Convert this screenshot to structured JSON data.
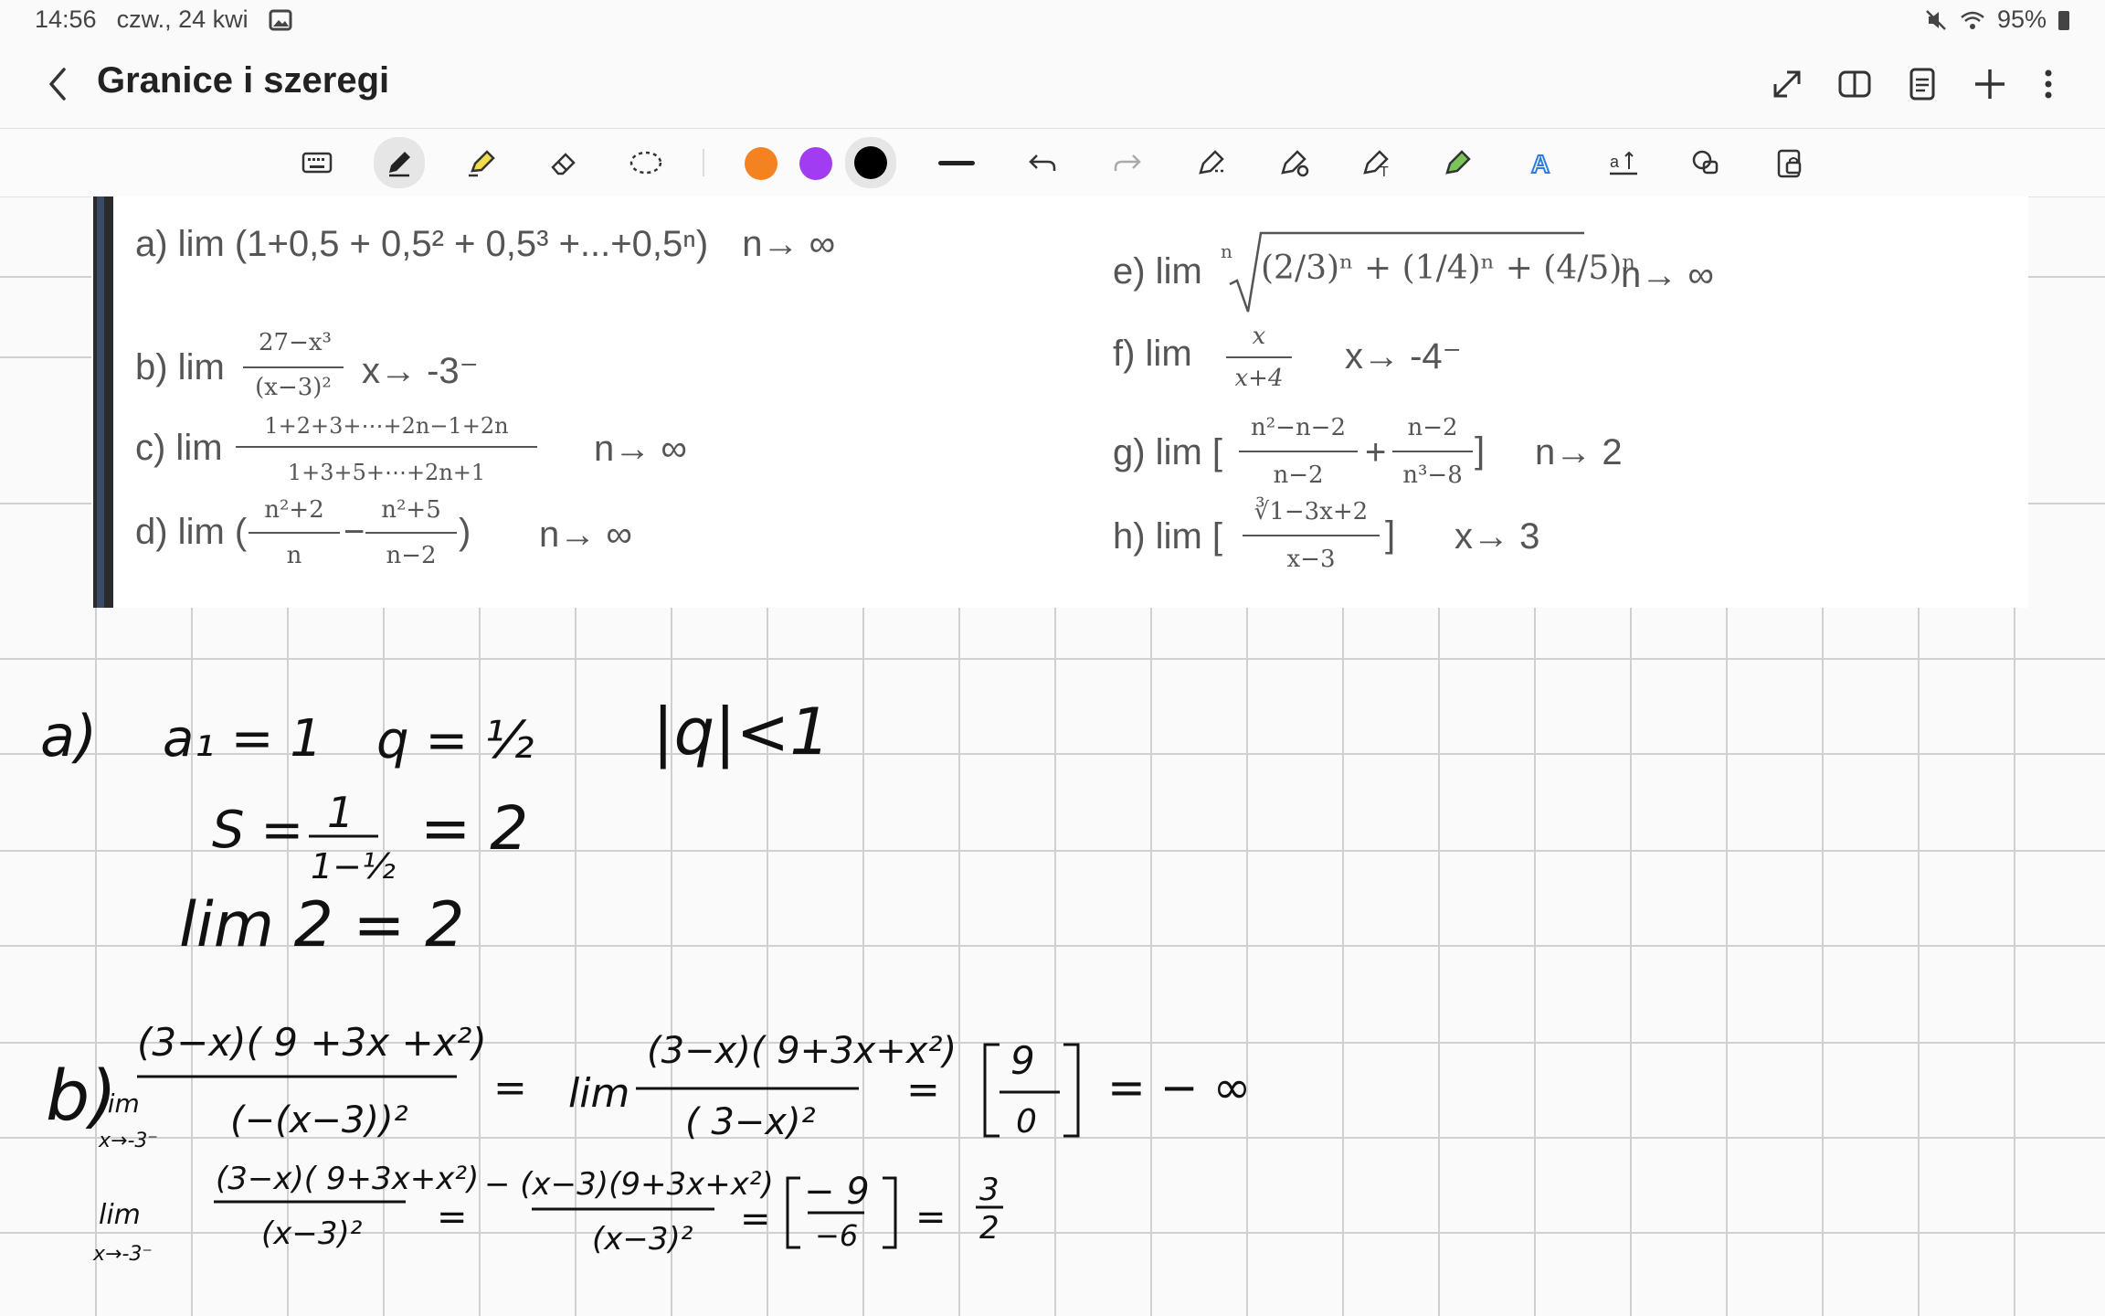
{
  "status": {
    "time": "14:56",
    "date": "czw., 24 kwi",
    "battery": "95%",
    "icons": [
      "gallery-icon",
      "mute-icon",
      "wifi-icon",
      "battery-icon"
    ]
  },
  "header": {
    "title": "Granice i szeregi",
    "actions": [
      "expand-icon",
      "book-view-icon",
      "page-icon",
      "add-icon",
      "more-icon"
    ]
  },
  "toolbar": {
    "tools": [
      "keyboard-icon",
      "pen-icon",
      "highlighter-icon",
      "eraser-icon",
      "lasso-icon"
    ],
    "colors": [
      "#F58220",
      "#A23CF2",
      "#000000"
    ],
    "actions": [
      "stroke-width-icon",
      "undo-icon",
      "redo-icon",
      "shape-pen-icon",
      "shape-fill-icon",
      "text-pen-icon",
      "marker-icon",
      "handwriting-icon",
      "text-format-icon",
      "shapes-icon",
      "lock-icon"
    ]
  },
  "exercises": {
    "a": {
      "label": "a) lim",
      "expr": "(1+0,5 + 0,5² + 0,5³ +...+0,5ⁿ)",
      "limit": "n→ ∞"
    },
    "b": {
      "label": "b) lim",
      "num": "27−x³",
      "den": "(x−3)²",
      "limit": "x→ -3⁻"
    },
    "c": {
      "label": "c) lim",
      "num": "1+2+3+⋯+2n−1+2n",
      "den": "1+3+5+⋯+2n+1",
      "limit": "n→ ∞"
    },
    "d": {
      "label": "d) lim (",
      "n1": "n²+2",
      "d1": "n",
      "op": "−",
      "n2": "n²+5",
      "d2": "n−2",
      "close": ")",
      "limit": "n→ ∞"
    },
    "e": {
      "label": "e) lim",
      "root": "n",
      "expr": "(2/3)ⁿ + (1/4)ⁿ + (4/5)ⁿ",
      "limit": "n→ ∞"
    },
    "f": {
      "label": "f)  lim",
      "num": "x",
      "den": "x+4",
      "limit": "x→ -4⁻"
    },
    "g": {
      "label": "g) lim [",
      "n1": "n²−n−2",
      "d1": "n−2",
      "op": "+",
      "n2": "n−2",
      "d2": "n³−8",
      "close": "]",
      "limit": "n→ 2"
    },
    "h": {
      "label": "h) lim [",
      "num": "∛1−3x+2",
      "den": "x−3",
      "close": "]",
      "limit": "x→ 3"
    }
  },
  "handwriting": {
    "a_label": "a)",
    "a1": "a₁ = 1",
    "q": "q = ½",
    "q_abs": "|q|<1",
    "s_left": "S =",
    "s_num": "1",
    "s_den": "1−½",
    "s_eq": "= 2",
    "lim_line": "lim  2  =  2",
    "b_label": "b)",
    "lim": "lim",
    "lim_sub": "x→-3⁻",
    "b_num1": "(3−x)( 9 +3x +x²)",
    "b_den1": "(−(x−3))²",
    "eq": "=",
    "b_num2": "(3−x)( 9+3x+x²)",
    "b_den2": "( 3−x)²",
    "b_br_num": "9",
    "b_br_den": "0",
    "b_result": "= − ∞",
    "b2_num1": "(3−x)( 9+3x+x²)",
    "b2_den1": "(x−3)²",
    "b2_num2": "− (x−3)(9+3x+x²)",
    "b2_den2": "(x−3)²",
    "b2_br_num": "− 9",
    "b2_br_den": "−6",
    "b2_result": "3",
    "b2_result_den": "2"
  }
}
